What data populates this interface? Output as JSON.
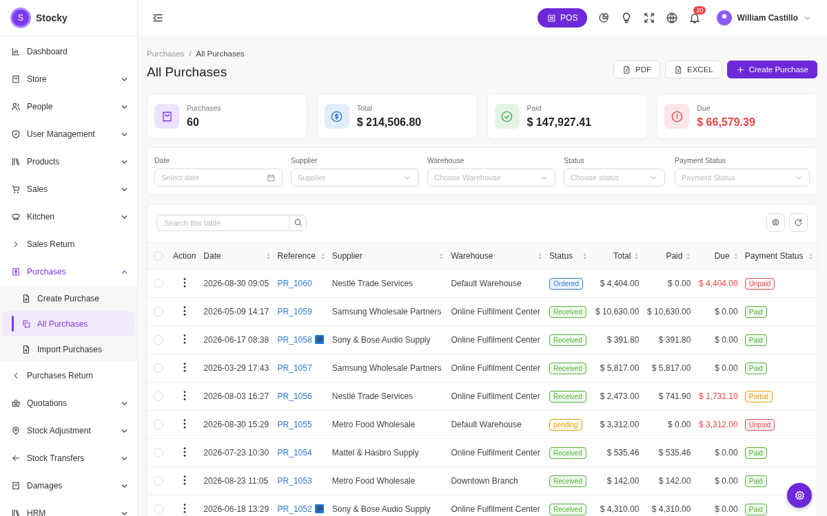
{
  "brand": {
    "logo_letter": "S",
    "name": "Stocky"
  },
  "sidebar": {
    "items": [
      {
        "label": "Dashboard",
        "kind": "link",
        "selected": false
      },
      {
        "label": "Store",
        "kind": "group",
        "expanded": false
      },
      {
        "label": "People",
        "kind": "group",
        "expanded": false
      },
      {
        "label": "User Management",
        "kind": "group",
        "expanded": false
      },
      {
        "label": "Products",
        "kind": "group",
        "expanded": false
      },
      {
        "label": "Sales",
        "kind": "group",
        "expanded": false
      },
      {
        "label": "Kitchen",
        "kind": "group",
        "expanded": false
      },
      {
        "label": "Sales Return",
        "kind": "link",
        "selected": false
      },
      {
        "label": "Purchases",
        "kind": "group",
        "expanded": true,
        "children": [
          {
            "label": "Create Purchase",
            "selected": false
          },
          {
            "label": "All Purchases",
            "selected": true
          },
          {
            "label": "Import Purchases",
            "selected": false
          }
        ]
      },
      {
        "label": "Purchases Return",
        "kind": "link",
        "selected": false
      },
      {
        "label": "Quotations",
        "kind": "group",
        "expanded": false
      },
      {
        "label": "Stock Adjustment",
        "kind": "group",
        "expanded": false
      },
      {
        "label": "Stock Transfers",
        "kind": "group",
        "expanded": false
      },
      {
        "label": "Damages",
        "kind": "group",
        "expanded": false
      },
      {
        "label": "HRM",
        "kind": "group",
        "expanded": false
      }
    ]
  },
  "topbar": {
    "pos_button": "POS",
    "notifications": "20",
    "user": "William Castillo"
  },
  "breadcrumb": {
    "items": [
      "Purchases",
      "All Purchases"
    ],
    "separator": "/"
  },
  "page_title": "All Purchases",
  "actions": [
    {
      "label": "PDF",
      "kind": "pdf"
    },
    {
      "label": "EXCEL",
      "kind": "excel"
    },
    {
      "label": "Create Purchase",
      "kind": "primary"
    }
  ],
  "stats": [
    {
      "label": "Purchases",
      "value": "60",
      "color": "#7c3aed",
      "alert": false
    },
    {
      "label": "Total",
      "value": "$ 214,506.80",
      "color": "#2f7ad9",
      "alert": false
    },
    {
      "label": "Paid",
      "value": "$ 147,927.41",
      "color": "#4caf50",
      "alert": false
    },
    {
      "label": "Due",
      "value": "$ 66,579.39",
      "color": "#e05252",
      "alert": true
    }
  ],
  "filters": [
    {
      "label": "Date",
      "placeholder": "Select date",
      "kind": "date"
    },
    {
      "label": "Supplier",
      "placeholder": "Supplier",
      "kind": "select"
    },
    {
      "label": "Warehouse",
      "placeholder": "Choose Warehouse",
      "kind": "select"
    },
    {
      "label": "Status",
      "placeholder": "Choose status",
      "kind": "select"
    },
    {
      "label": "Payment Status",
      "placeholder": "Payment Status",
      "kind": "select"
    }
  ],
  "table": {
    "search": {
      "placeholder": "Search this table"
    },
    "select_all_checked": false,
    "columns": [
      {
        "label": "Action",
        "sortable": false,
        "kind": "text"
      },
      {
        "label": "Date",
        "sortable": true,
        "kind": "text"
      },
      {
        "label": "Reference",
        "sortable": true,
        "kind": "text"
      },
      {
        "label": "Supplier",
        "sortable": true,
        "kind": "text"
      },
      {
        "label": "Warehouse",
        "sortable": true,
        "kind": "text"
      },
      {
        "label": "Status",
        "sortable": true,
        "kind": "text"
      },
      {
        "label": "Total",
        "sortable": true,
        "kind": "money"
      },
      {
        "label": "Paid",
        "sortable": true,
        "kind": "money"
      },
      {
        "label": "Due",
        "sortable": true,
        "kind": "money"
      },
      {
        "label": "Payment Status",
        "sortable": true,
        "kind": "text"
      }
    ],
    "rows": [
      {
        "checked": false,
        "date": "2026-08-30 09:05",
        "reference": "PR_1060",
        "returned": false,
        "supplier": "Nestlé Trade Services",
        "warehouse": "Default Warehouse",
        "status": {
          "label": "Ordered",
          "color": "#2f7ad9"
        },
        "total": "$ 4,404.00",
        "paid": "$ 0.00",
        "due": "$ 4,404.00",
        "due_alert": true,
        "payment": {
          "label": "Unpaid",
          "color": "#e05252"
        }
      },
      {
        "checked": false,
        "date": "2026-05-09 14:17",
        "reference": "PR_1059",
        "returned": false,
        "supplier": "Samsung Wholesale Partners",
        "warehouse": "Online Fulfilment Center",
        "status": {
          "label": "Received",
          "color": "#52b436"
        },
        "total": "$ 10,630.00",
        "paid": "$ 10,630.00",
        "due": "$ 0.00",
        "due_alert": false,
        "payment": {
          "label": "Paid",
          "color": "#52b436"
        }
      },
      {
        "checked": false,
        "date": "2026-06-17 08:38",
        "reference": "PR_1058",
        "returned": true,
        "supplier": "Sony & Bose Audio Supply",
        "warehouse": "Online Fulfilment Center",
        "status": {
          "label": "Received",
          "color": "#52b436"
        },
        "total": "$ 391.80",
        "paid": "$ 391.80",
        "due": "$ 0.00",
        "due_alert": false,
        "payment": {
          "label": "Paid",
          "color": "#52b436"
        }
      },
      {
        "checked": false,
        "date": "2026-03-29 17:43",
        "reference": "PR_1057",
        "returned": false,
        "supplier": "Samsung Wholesale Partners",
        "warehouse": "Online Fulfilment Center",
        "status": {
          "label": "Received",
          "color": "#52b436"
        },
        "total": "$ 5,817.00",
        "paid": "$ 5,817.00",
        "due": "$ 0.00",
        "due_alert": false,
        "payment": {
          "label": "Paid",
          "color": "#52b436"
        }
      },
      {
        "checked": false,
        "date": "2026-08-03 16:27",
        "reference": "PR_1056",
        "returned": false,
        "supplier": "Nestlé Trade Services",
        "warehouse": "Online Fulfilment Center",
        "status": {
          "label": "Received",
          "color": "#52b436"
        },
        "total": "$ 2,473.00",
        "paid": "$ 741.90",
        "due": "$ 1,731.10",
        "due_alert": true,
        "payment": {
          "label": "Partial",
          "color": "#e3a21a"
        }
      },
      {
        "checked": false,
        "date": "2026-08-30 15:29",
        "reference": "PR_1055",
        "returned": false,
        "supplier": "Metro Food Wholesale",
        "warehouse": "Default Warehouse",
        "status": {
          "label": "pending",
          "color": "#e3a21a"
        },
        "total": "$ 3,312.00",
        "paid": "$ 0.00",
        "due": "$ 3,312.00",
        "due_alert": true,
        "payment": {
          "label": "Unpaid",
          "color": "#e05252"
        }
      },
      {
        "checked": false,
        "date": "2026-07-23 10:30",
        "reference": "PR_1054",
        "returned": false,
        "supplier": "Mattel & Hasbro Supply",
        "warehouse": "Online Fulfilment Center",
        "status": {
          "label": "Received",
          "color": "#52b436"
        },
        "total": "$ 535.46",
        "paid": "$ 535.46",
        "due": "$ 0.00",
        "due_alert": false,
        "payment": {
          "label": "Paid",
          "color": "#52b436"
        }
      },
      {
        "checked": false,
        "date": "2026-08-23 11:05",
        "reference": "PR_1053",
        "returned": false,
        "supplier": "Metro Food Wholesale",
        "warehouse": "Downtown Branch",
        "status": {
          "label": "Received",
          "color": "#52b436"
        },
        "total": "$ 142.00",
        "paid": "$ 142.00",
        "due": "$ 0.00",
        "due_alert": false,
        "payment": {
          "label": "Paid",
          "color": "#52b436"
        }
      },
      {
        "checked": false,
        "date": "2026-06-18 13:29",
        "reference": "PR_1052",
        "returned": true,
        "supplier": "Sony & Bose Audio Supply",
        "warehouse": "Online Fulfilment Center",
        "status": {
          "label": "Received",
          "color": "#52b436"
        },
        "total": "$ 4,310.00",
        "paid": "$ 4,310.00",
        "due": "$ 0.00",
        "due_alert": false,
        "payment": {
          "label": "Paid",
          "color": "#52b436"
        }
      }
    ]
  }
}
